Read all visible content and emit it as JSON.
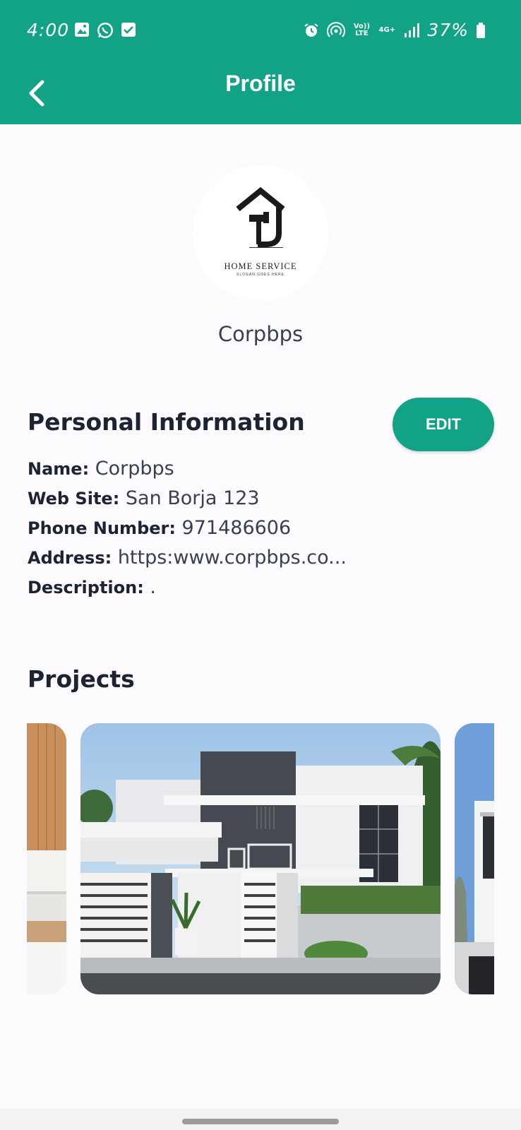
{
  "status_bar": {
    "time": "4:00",
    "battery": "37%",
    "network_volte": "Vo)) LTE",
    "network_4g": "4G+"
  },
  "app_bar": {
    "title": "Profile",
    "back_icon": "chevron-left-icon"
  },
  "profile": {
    "logo_text": "HOME SERVICE",
    "logo_subtext": "SLOGAN GOES HERE",
    "name": "Corpbps"
  },
  "personal_info": {
    "title": "Personal Information",
    "edit_label": "EDIT",
    "rows": [
      {
        "label": "Name:",
        "value": "Corpbps"
      },
      {
        "label": "Web Site:",
        "value": "San Borja 123"
      },
      {
        "label": "Phone Number:",
        "value": "971486606"
      },
      {
        "label": "Address:",
        "value": "https:www.corpbps.co..."
      },
      {
        "label": "Description:",
        "value": "."
      }
    ]
  },
  "projects": {
    "title": "Projects"
  },
  "colors": {
    "accent": "#12a386",
    "background": "#fcfafd",
    "heading": "#1c2434"
  }
}
